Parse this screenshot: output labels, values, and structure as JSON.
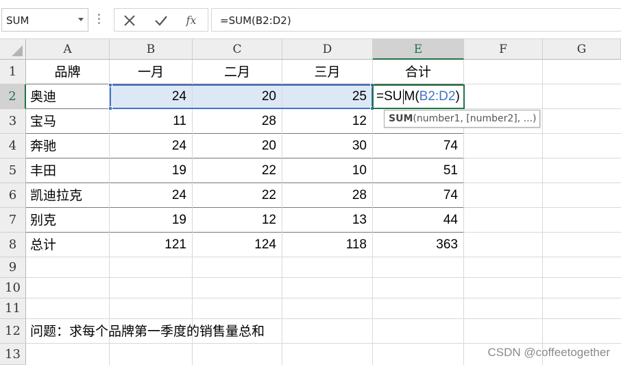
{
  "name_box": "SUM",
  "formula": "=SUM(B2:D2)",
  "columns": [
    "A",
    "B",
    "C",
    "D",
    "E",
    "F",
    "G"
  ],
  "rows": [
    "1",
    "2",
    "3",
    "4",
    "5",
    "6",
    "7",
    "8",
    "9",
    "10",
    "11",
    "12",
    "13"
  ],
  "header": {
    "brand": "品牌",
    "jan": "一月",
    "feb": "二月",
    "mar": "三月",
    "total": "合计"
  },
  "table": [
    {
      "brand": "奥迪",
      "jan": "24",
      "feb": "20",
      "mar": "25",
      "total": ""
    },
    {
      "brand": "宝马",
      "jan": "11",
      "feb": "28",
      "mar": "12",
      "total": ""
    },
    {
      "brand": "奔驰",
      "jan": "24",
      "feb": "20",
      "mar": "30",
      "total": "74"
    },
    {
      "brand": "丰田",
      "jan": "19",
      "feb": "22",
      "mar": "10",
      "total": "51"
    },
    {
      "brand": "凯迪拉克",
      "jan": "24",
      "feb": "22",
      "mar": "28",
      "total": "74"
    },
    {
      "brand": "别克",
      "jan": "19",
      "feb": "12",
      "mar": "13",
      "total": "44"
    },
    {
      "brand": "总计",
      "jan": "121",
      "feb": "124",
      "mar": "118",
      "total": "363"
    }
  ],
  "editing": {
    "prefix": "=SU",
    "suffix": "M(",
    "ref": "B2:D2",
    "close": ")"
  },
  "tooltip": {
    "fn": "SUM",
    "args": "(number1, [number2], ...)"
  },
  "note": "问题：求每个品牌第一季度的销售量总和",
  "watermark": "CSDN @coffeetogether",
  "colors": {
    "accent_green": "#217346",
    "range_blue": "#4472c4",
    "highlight": "#dde8f7"
  }
}
